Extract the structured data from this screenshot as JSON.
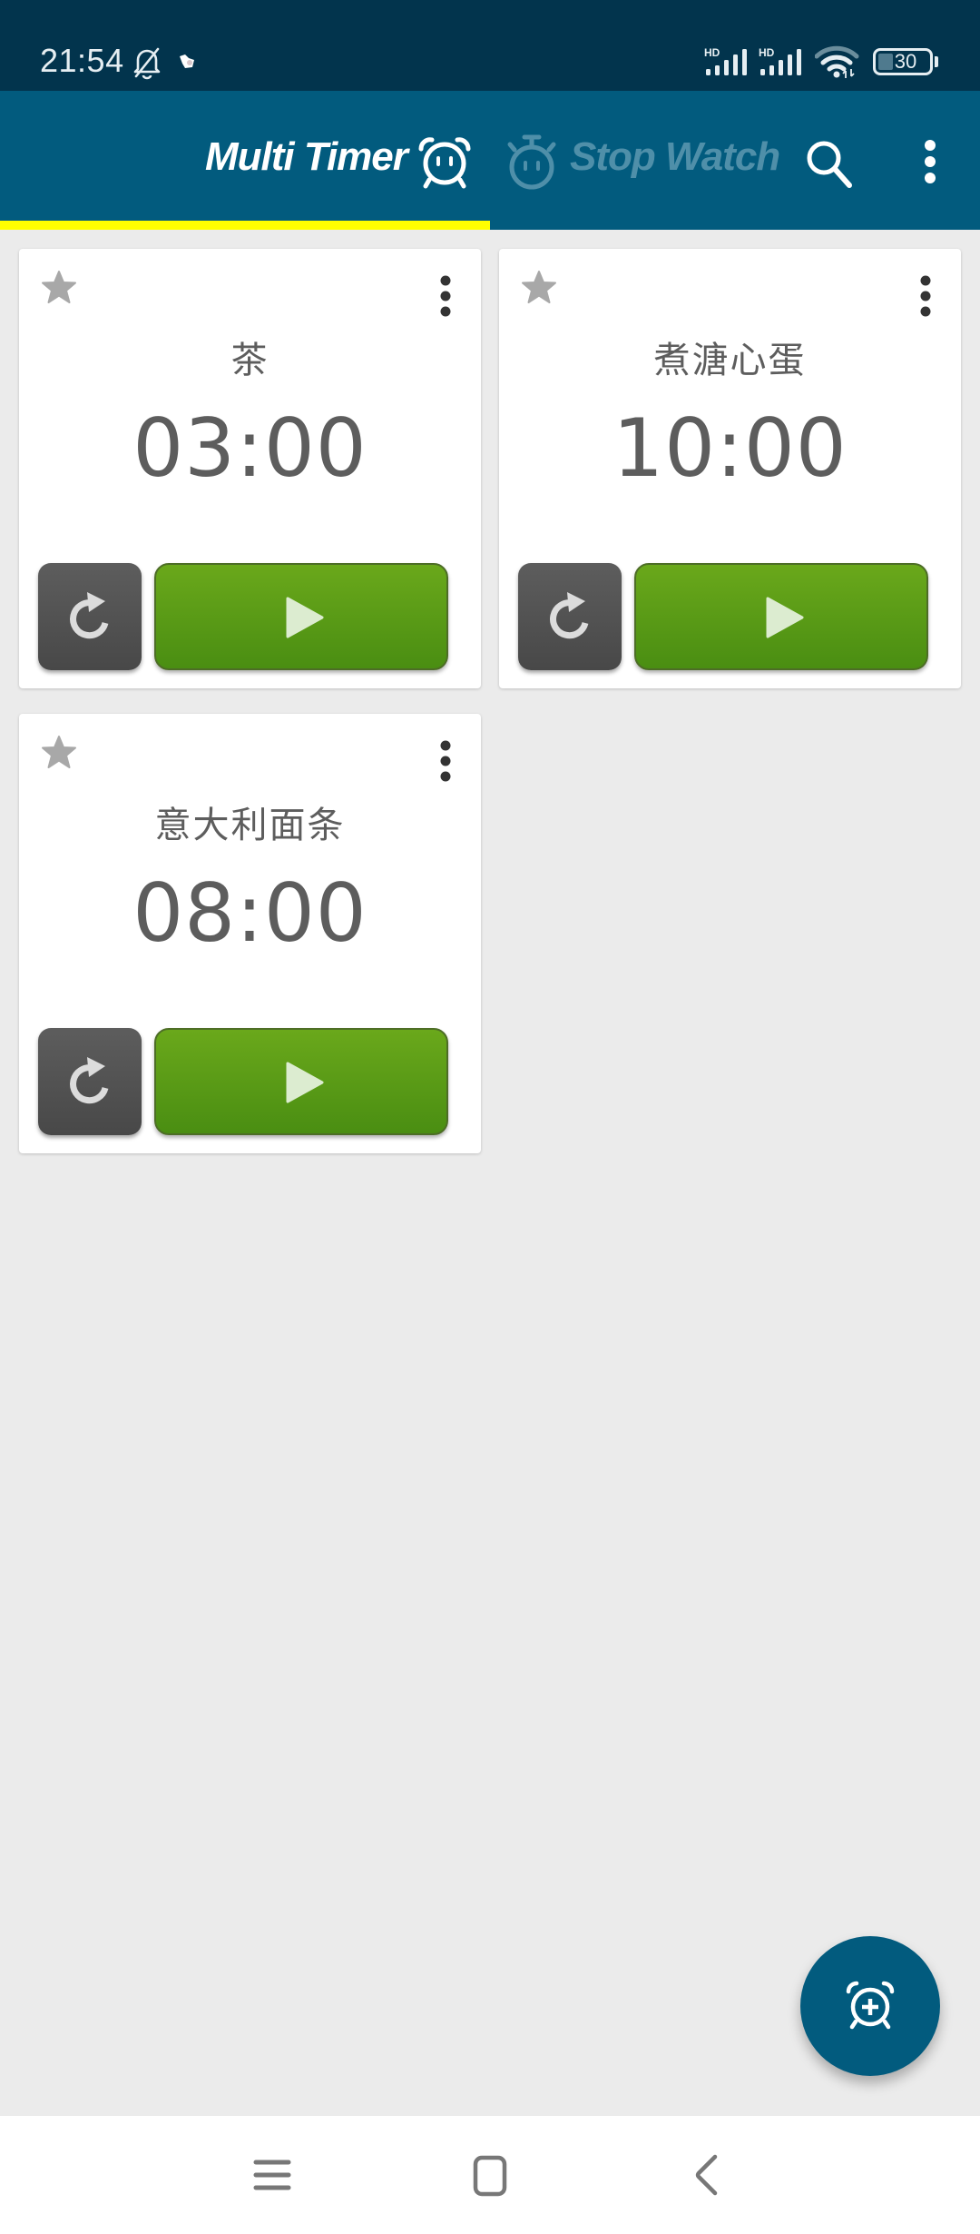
{
  "status_bar": {
    "time": "21:54",
    "icons": [
      "bell-off-icon",
      "app-notification-icon",
      "hd-signal-icon",
      "hd-signal-icon",
      "wifi-icon"
    ],
    "signal_label_1": "HD",
    "signal_label_2": "HD",
    "battery_level": "30"
  },
  "app_bar": {
    "tabs": [
      {
        "label": "Multi Timer",
        "icon": "alarm-clock-icon",
        "selected": true
      },
      {
        "label": "Stop Watch",
        "icon": "stopwatch-icon",
        "selected": false
      }
    ],
    "actions": [
      "search-icon",
      "more-vert-icon"
    ]
  },
  "colors": {
    "status_bar_bg": "#02344d",
    "app_bar_bg": "#025b7e",
    "tab_indicator": "#ffff00",
    "inactive_tab": "#4f8fa9",
    "background": "#ebebeb",
    "play_button": "#5a9c17",
    "reset_button": "#525252",
    "text": "#5d5d5d"
  },
  "timers": [
    {
      "title": "茶",
      "time": "03:00",
      "favorite": false
    },
    {
      "title": "煮溏心蛋",
      "time": "10:00",
      "favorite": false
    },
    {
      "title": "意大利面条",
      "time": "08:00",
      "favorite": false
    }
  ],
  "fab": {
    "icon": "add-alarm-icon"
  },
  "nav_bar": {
    "buttons": [
      "menu-icon",
      "home-icon",
      "back-icon"
    ]
  }
}
